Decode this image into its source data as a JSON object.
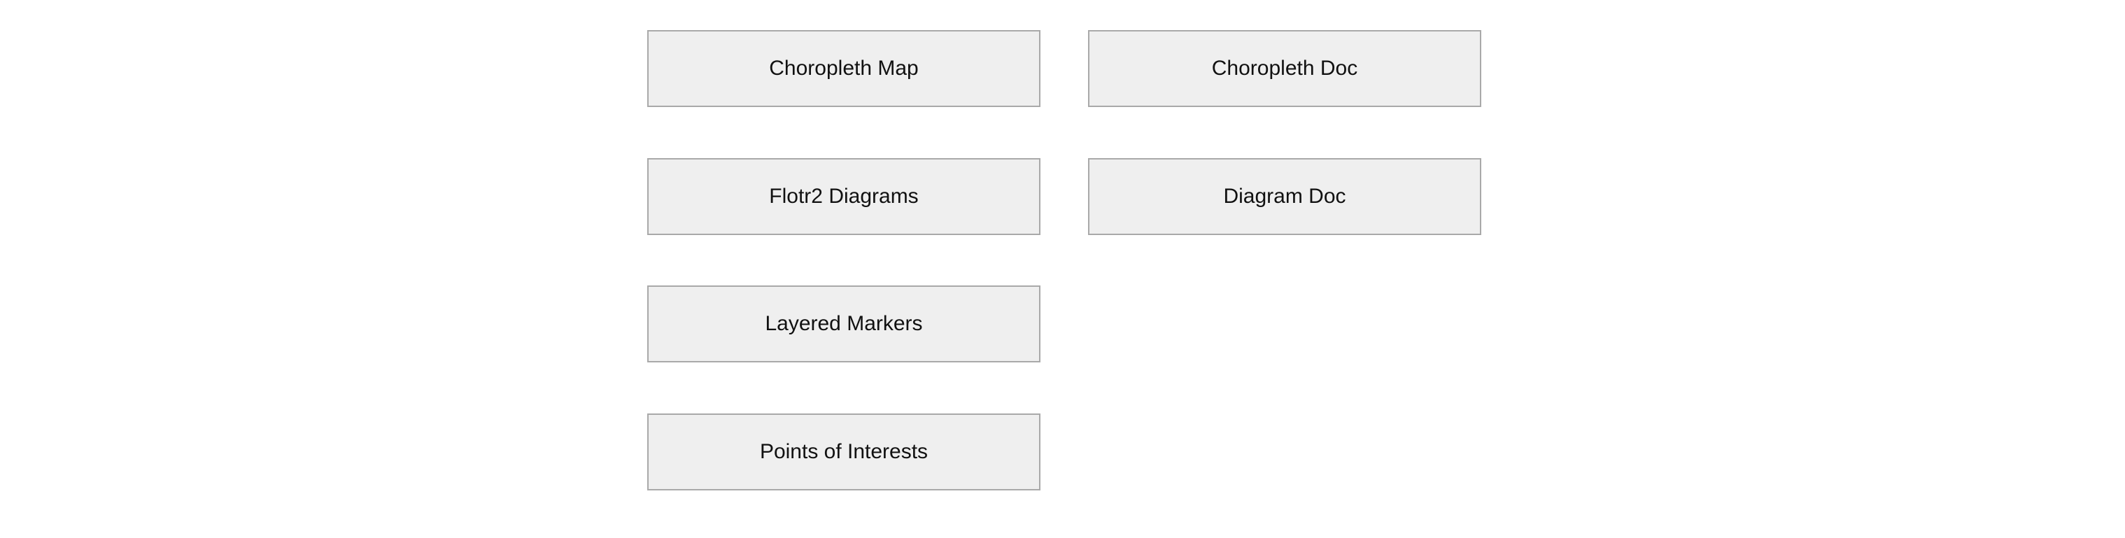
{
  "links": {
    "choropleth_map": "Choropleth Map",
    "choropleth_doc": "Choropleth Doc",
    "flotr2_diagrams": "Flotr2 Diagrams",
    "diagram_doc": "Diagram Doc",
    "layered_markers": "Layered Markers",
    "points_of_interests": "Points of Interests"
  }
}
